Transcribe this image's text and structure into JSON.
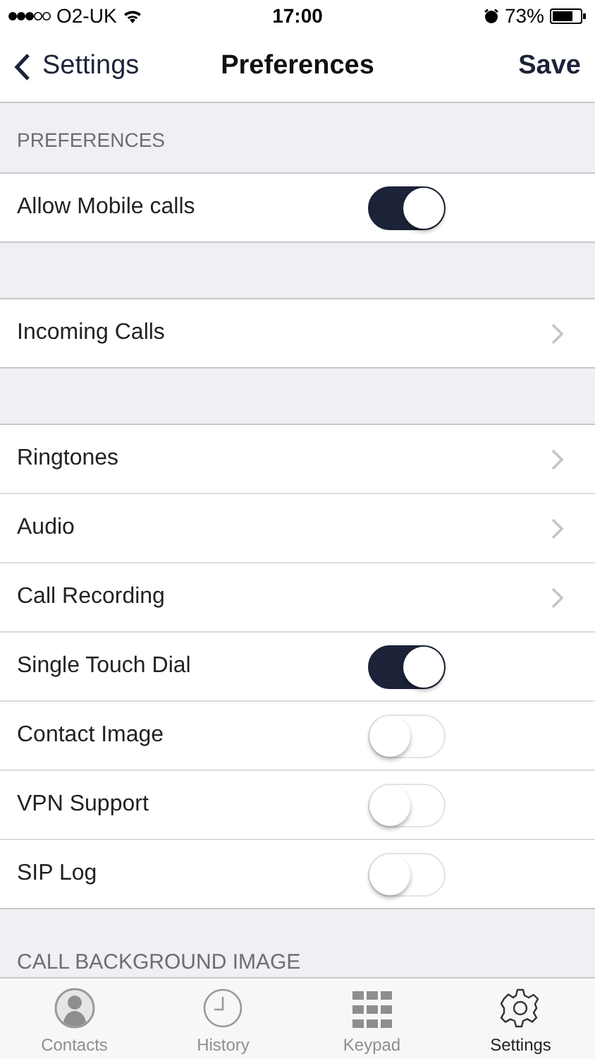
{
  "status_bar": {
    "carrier": "O2-UK",
    "time": "17:00",
    "battery": "73%"
  },
  "nav": {
    "back": "Settings",
    "title": "Preferences",
    "action": "Save"
  },
  "sections": [
    {
      "header": "PREFERENCES",
      "rows": [
        {
          "kind": "toggle",
          "label": "Allow Mobile calls",
          "on": true
        }
      ]
    },
    {
      "rows": [
        {
          "kind": "link",
          "label": "Incoming Calls"
        }
      ]
    },
    {
      "rows": [
        {
          "kind": "link",
          "label": "Ringtones"
        },
        {
          "kind": "link",
          "label": "Audio"
        },
        {
          "kind": "link",
          "label": "Call Recording"
        },
        {
          "kind": "toggle",
          "label": "Single Touch Dial",
          "on": true
        },
        {
          "kind": "toggle",
          "label": "Contact Image",
          "on": false
        },
        {
          "kind": "toggle",
          "label": "VPN Support",
          "on": false
        },
        {
          "kind": "toggle",
          "label": "SIP Log",
          "on": false
        }
      ]
    },
    {
      "header": "CALL BACKGROUND IMAGE"
    }
  ],
  "tabs": [
    {
      "kind": "contacts",
      "label": "Contacts",
      "selected": false
    },
    {
      "kind": "history",
      "label": "History",
      "selected": false
    },
    {
      "kind": "keypad",
      "label": "Keypad",
      "selected": false
    },
    {
      "kind": "settings",
      "label": "Settings",
      "selected": true
    }
  ]
}
